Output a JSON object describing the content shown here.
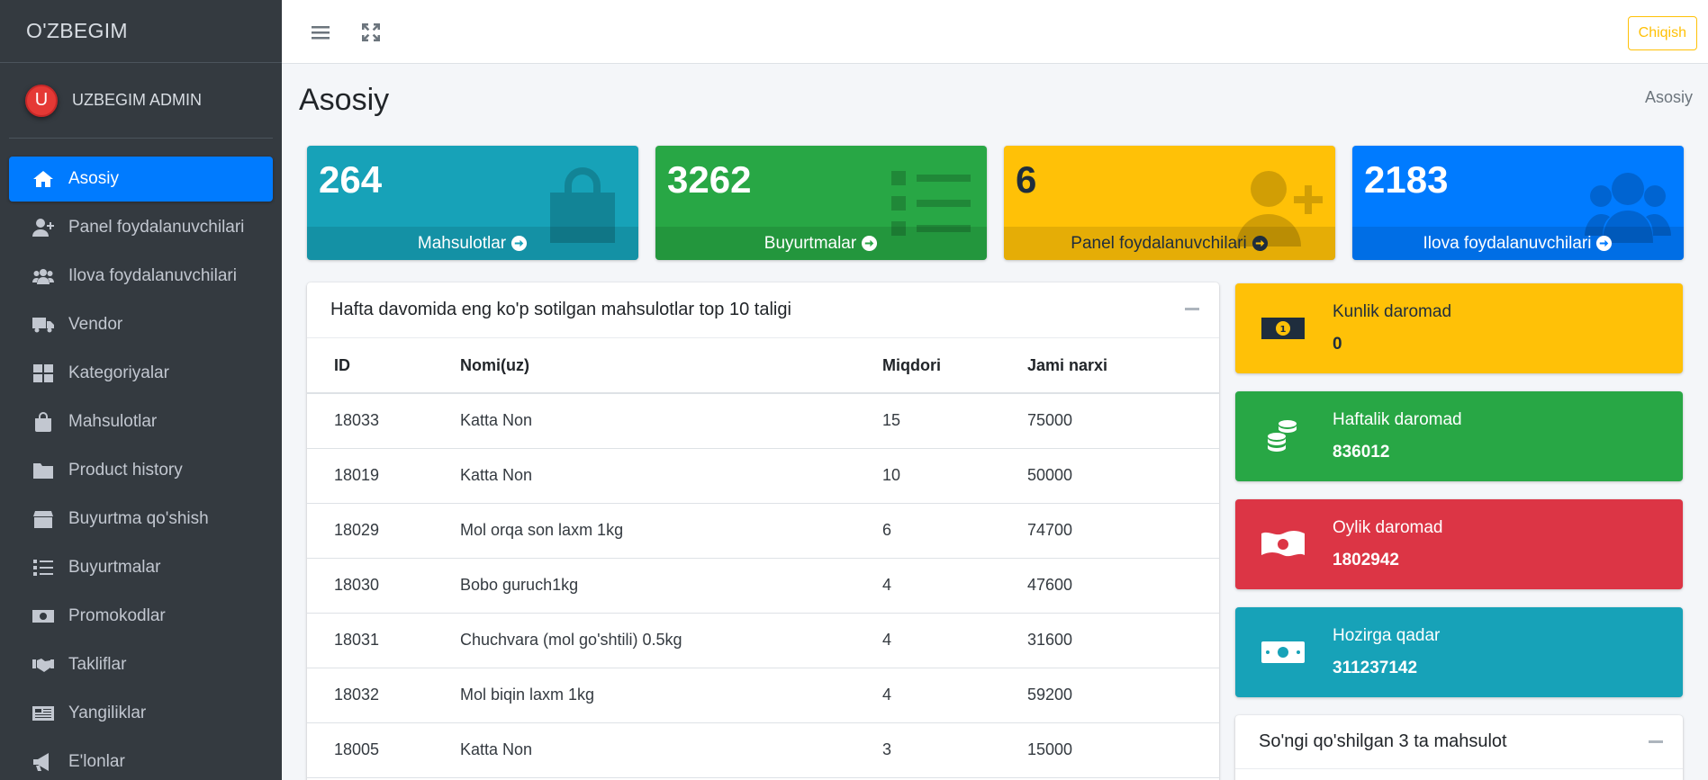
{
  "brand": "O'ZBEGIM",
  "user": {
    "avatar_letter": "U",
    "name": "UZBEGIM ADMIN"
  },
  "sidebar": {
    "items": [
      {
        "label": "Asosiy",
        "icon": "home-icon",
        "active": true
      },
      {
        "label": "Panel foydalanuvchilari",
        "icon": "user-plus-icon"
      },
      {
        "label": "Ilova foydalanuvchilari",
        "icon": "users-icon"
      },
      {
        "label": "Vendor",
        "icon": "truck-icon"
      },
      {
        "label": "Kategoriyalar",
        "icon": "grid-icon"
      },
      {
        "label": "Mahsulotlar",
        "icon": "shopping-bag-icon"
      },
      {
        "label": "Product history",
        "icon": "folder-icon"
      },
      {
        "label": "Buyurtma qo'shish",
        "icon": "box-icon"
      },
      {
        "label": "Buyurtmalar",
        "icon": "list-icon"
      },
      {
        "label": "Promokodlar",
        "icon": "money-bill-icon"
      },
      {
        "label": "Takliflar",
        "icon": "handshake-icon"
      },
      {
        "label": "Yangiliklar",
        "icon": "newspaper-icon"
      },
      {
        "label": "E'lonlar",
        "icon": "bullhorn-icon"
      }
    ]
  },
  "topbar": {
    "logout_label": "Chiqish"
  },
  "page": {
    "title": "Asosiy",
    "breadcrumb": "Asosiy"
  },
  "stats": [
    {
      "value": "264",
      "label": "Mahsulotlar",
      "color": "#17a2b8",
      "icon": "shopping-bag-icon"
    },
    {
      "value": "3262",
      "label": "Buyurtmalar",
      "color": "#28a745",
      "icon": "list-icon"
    },
    {
      "value": "6",
      "label": "Panel foydalanuvchilari",
      "color": "#ffc107",
      "icon": "user-plus-icon"
    },
    {
      "value": "2183",
      "label": "Ilova foydalanuvchilari",
      "color": "#007bff",
      "icon": "users-icon"
    }
  ],
  "top_products": {
    "title": "Hafta davomida eng ko'p sotilgan mahsulotlar top 10 taligi",
    "columns": [
      "ID",
      "Nomi(uz)",
      "Miqdori",
      "Jami narxi"
    ],
    "rows": [
      [
        "18033",
        "Katta Non",
        "15",
        "75000"
      ],
      [
        "18019",
        "Katta Non",
        "10",
        "50000"
      ],
      [
        "18029",
        "Mol orqa son laxm 1kg",
        "6",
        "74700"
      ],
      [
        "18030",
        "Bobo guruch1kg",
        "4",
        "47600"
      ],
      [
        "18031",
        "Chuchvara (mol go'shtili) 0.5kg",
        "4",
        "31600"
      ],
      [
        "18032",
        "Mol biqin laxm 1kg",
        "4",
        "59200"
      ],
      [
        "18005",
        "Katta Non",
        "3",
        "15000"
      ]
    ]
  },
  "income": [
    {
      "label": "Kunlik daromad",
      "value": "0",
      "color": "#ffc107",
      "icon": "money-coin-icon"
    },
    {
      "label": "Haftalik daromad",
      "value": "836012",
      "color": "#28a745",
      "icon": "coins-icon"
    },
    {
      "label": "Oylik daromad",
      "value": "1802942",
      "color": "#dc3545",
      "icon": "money-bill-wave-icon"
    },
    {
      "label": "Hozirga qadar",
      "value": "311237142",
      "color": "#17a2b8",
      "icon": "money-bill-icon"
    }
  ],
  "recent_products": {
    "title": "So'ngi qo'shilgan 3 ta mahsulot"
  }
}
